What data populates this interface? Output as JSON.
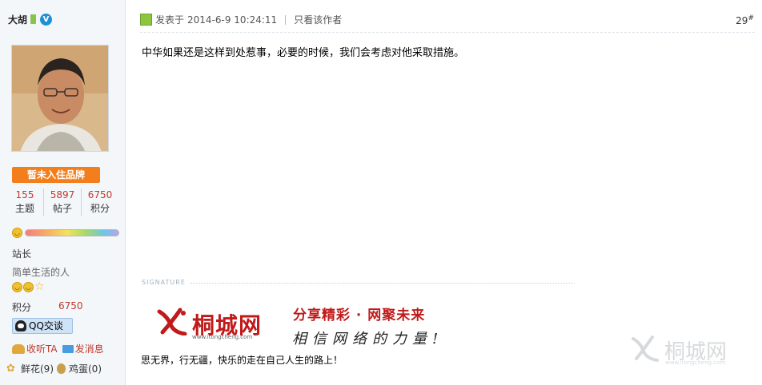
{
  "user": {
    "name": "大胡",
    "verified_badge": "V",
    "brand_button": "暂未入住品牌",
    "stats": [
      {
        "value": "155",
        "label": "主题"
      },
      {
        "value": "5897",
        "label": "帖子"
      },
      {
        "value": "6750",
        "label": "积分"
      }
    ],
    "rank": "站长",
    "motto": "简单生活的人",
    "points_label": "积分",
    "points_value": "6750",
    "qq_button": "QQ交谈",
    "follow_label": "收听TA",
    "message_label": "发消息",
    "flower_label": "鲜花(9)",
    "egg_label": "鸡蛋(0)"
  },
  "post": {
    "meta_prefix": "发表于",
    "datetime": "2014-6-9 10:24:11",
    "only_author": "只看该作者",
    "floor": "29",
    "floor_mark": "#",
    "content": "中华如果还是这样到处惹事，必要的时候，我们会考虑对他采取措施。"
  },
  "signature": {
    "label": "SIGNATURE",
    "logo_text": "桐城网",
    "logo_url": "www.itongcheng.com",
    "slogan": "分享精彩 · 网聚未来",
    "slogan2": "相信网络的力量!",
    "text": "思无界，行无疆，快乐的走在自己人生的路上！"
  },
  "watermark": {
    "text": "桐城网",
    "url": "www.itongcheng.com"
  },
  "colors": {
    "accent_red": "#c01a1a",
    "brand_orange": "#f37f1c",
    "stat_red": "#c0392b"
  }
}
